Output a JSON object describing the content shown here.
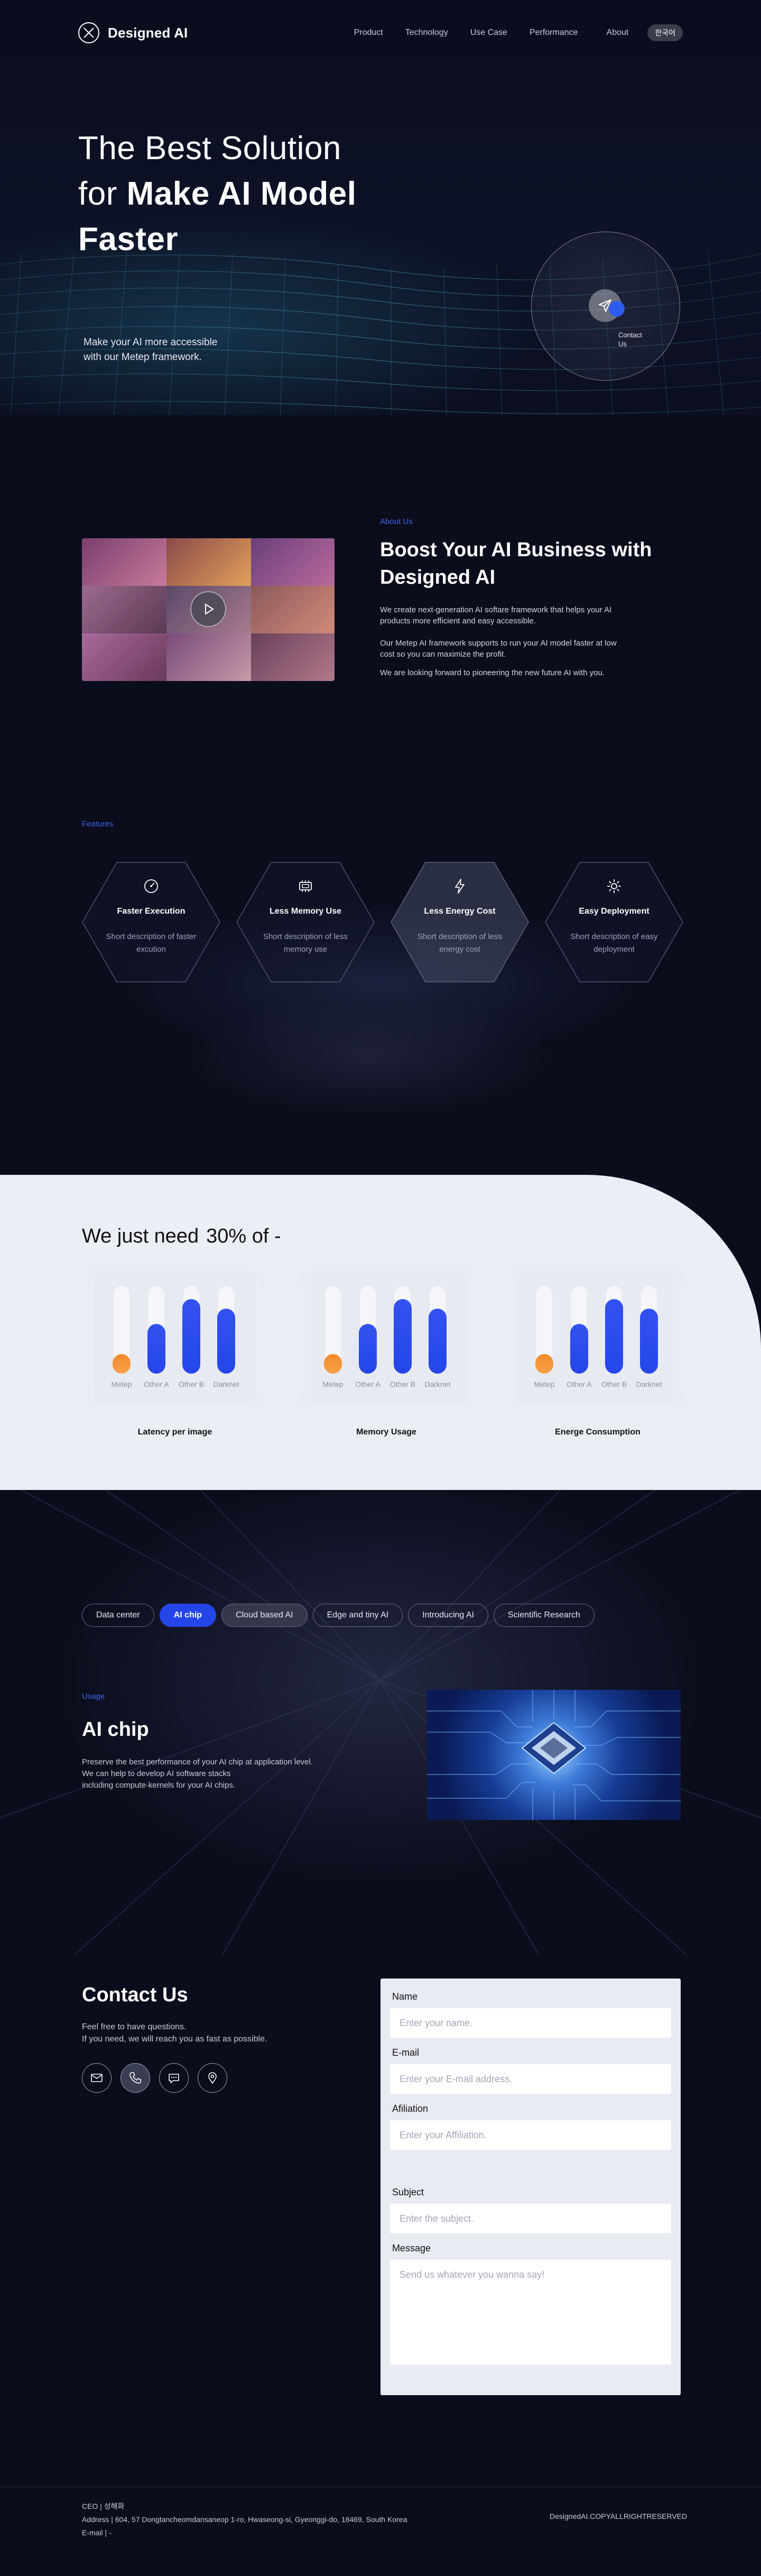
{
  "brand": {
    "name": "Designed AI"
  },
  "nav": {
    "items": [
      "Product",
      "Technology",
      "Use Case",
      "Performance",
      "About"
    ],
    "lang": "한국어"
  },
  "hero": {
    "title_line1": "The Best Solution",
    "title_for": "for ",
    "title_line2_bold": "Make AI Model",
    "title_line3_bold": "Faster",
    "sub_line1": "Make your AI more accessible",
    "sub_line2": "with our Metep framework.",
    "contact_line1": "Contact",
    "contact_line2": "Us"
  },
  "about": {
    "eyebrow": "About Us",
    "title": "Boost Your AI Business with Designed AI",
    "p1": "We create next-generation AI softare framework that helps your AI products more efficient and easy accessible.",
    "p2": "Our Metep AI framework supports to run your AI model faster at low cost so you can maximize the profit.",
    "p3": "We are looking forward to pioneering the new future AI with you."
  },
  "features": {
    "eyebrow": "Features",
    "items": [
      {
        "title": "Faster Execution",
        "desc": "Short description of faster excution",
        "icon": "speedometer-icon"
      },
      {
        "title": "Less Memory Use",
        "desc": "Short description of less memory use",
        "icon": "memory-chip-icon"
      },
      {
        "title": "Less Energy Cost",
        "desc": "Short description of less energy cost",
        "icon": "lightning-icon"
      },
      {
        "title": "Easy Deployment",
        "desc": "Short description of easy deployment",
        "icon": "gear-icon"
      }
    ]
  },
  "stats": {
    "title_a": "We just need",
    "title_b": "30% of -",
    "bar_labels": [
      "Metep",
      "Other A",
      "Other B",
      "Darknet"
    ],
    "colors": {
      "metep": "#f28a2a",
      "others": "#2446e8"
    },
    "cards": [
      {
        "caption": "Latency per image",
        "levels": [
          0.22,
          0.56,
          0.84,
          0.73
        ]
      },
      {
        "caption": "Memory Usage",
        "levels": [
          0.22,
          0.56,
          0.84,
          0.73
        ]
      },
      {
        "caption": "Energe Consumption",
        "levels": [
          0.22,
          0.56,
          0.84,
          0.73
        ]
      }
    ]
  },
  "usage": {
    "tabs": [
      "Data center",
      "AI chip",
      "Cloud based AI",
      "Edge and tiny AI",
      "Introducing AI",
      "Scientific Research"
    ],
    "active_tab": "AI chip",
    "eyebrow": "Usage",
    "title": "AI chip",
    "p1": "Preserve the best performance of your AI chip at application level.",
    "p2": "We can help to develop AI software stacks",
    "p3": "including compute-kernels for your AI chips."
  },
  "contact": {
    "title": "Contact Us",
    "p1": "Feel free to have questions.",
    "p2": "If you need, we will reach you as fast as possible.",
    "icons": [
      "mail-icon",
      "phone-icon",
      "chat-icon",
      "location-icon"
    ],
    "form": {
      "name_label": "Name",
      "name_placeholder": "Enter your name.",
      "email_label": "E-mail",
      "email_placeholder": "Enter your E-mail address.",
      "affiliation_label": "Afiliation",
      "affiliation_placeholder": "Enter your Affiliation.",
      "subject_label": "Subject",
      "subject_placeholder": "Enter the subject.",
      "message_label": "Message",
      "message_placeholder": "Send us whatever you wanna say!"
    }
  },
  "footer": {
    "ceo": "CEO  |  성해화",
    "address": "Address  |  604, 57 Dongtancheomdansaneop 1-ro, Hwaseong-si, Gyeonggi-do, 18469, South Korea",
    "email": "E-mail  |  -",
    "copyright": "DesignedAI.COPYALLRIGHTRESERVED"
  }
}
